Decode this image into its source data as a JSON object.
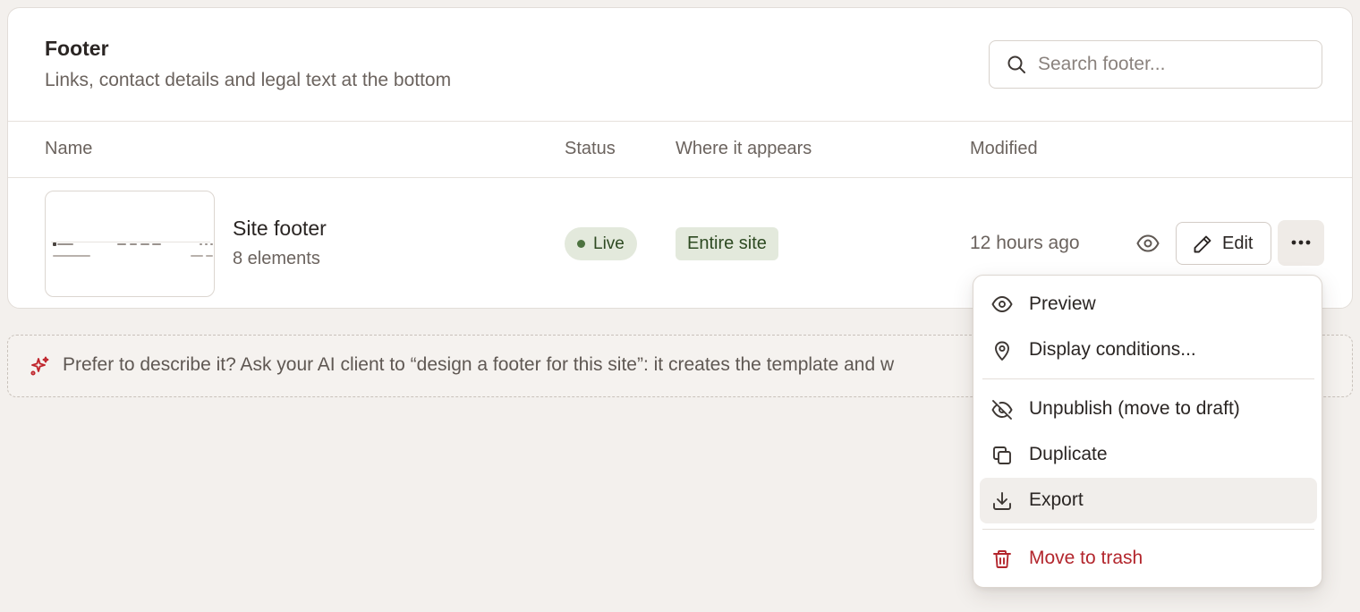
{
  "panel": {
    "title": "Footer",
    "subtitle": "Links, contact details and legal text at the bottom",
    "search_placeholder": "Search footer..."
  },
  "table": {
    "columns": [
      "Name",
      "Status",
      "Where it appears",
      "Modified"
    ],
    "rows": [
      {
        "name": "Site footer",
        "meta": "8 elements",
        "status": "Live",
        "where": "Entire site",
        "modified": "12 hours ago",
        "edit_label": "Edit"
      }
    ]
  },
  "hint": {
    "text": "Prefer to describe it? Ask your AI client to “design a footer for this site”: it creates the template and w"
  },
  "menu": {
    "items": [
      {
        "label": "Preview",
        "icon": "eye-icon"
      },
      {
        "label": "Display conditions...",
        "icon": "map-pin-icon"
      },
      {
        "label": "Unpublish (move to draft)",
        "icon": "eye-off-icon"
      },
      {
        "label": "Duplicate",
        "icon": "copy-icon"
      },
      {
        "label": "Export",
        "icon": "download-icon"
      },
      {
        "label": "Move to trash",
        "icon": "trash-icon"
      }
    ]
  },
  "colors": {
    "page_bg": "#f3f0ed",
    "badge_bg": "#e3e9dc",
    "badge_text": "#2e4a22",
    "danger": "#b3262d",
    "accent_spark": "#c0262d"
  }
}
